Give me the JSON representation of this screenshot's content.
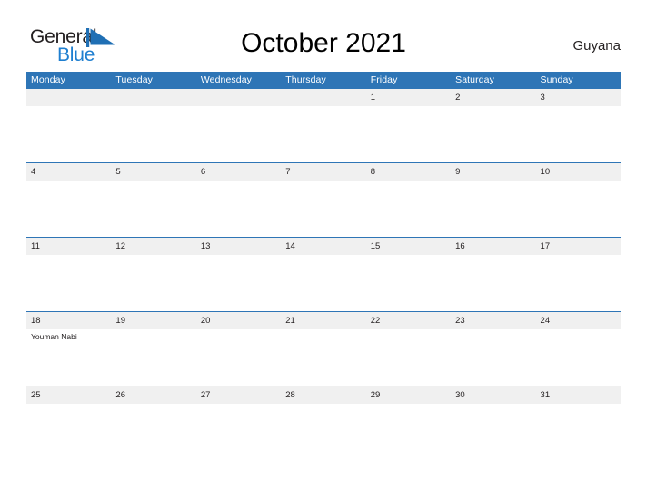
{
  "brand": {
    "name_part1": "General",
    "name_part2": "Blue",
    "flag_icon": "blue-triangle-flag-icon",
    "color_dark": "#231F20",
    "color_blue": "#1F7FD0"
  },
  "header": {
    "title": "October 2021",
    "country": "Guyana"
  },
  "calendar": {
    "accent_color": "#2E75B6",
    "band_color": "#F0F0F0",
    "weekday_headers": [
      "Monday",
      "Tuesday",
      "Wednesday",
      "Thursday",
      "Friday",
      "Saturday",
      "Sunday"
    ],
    "weeks": [
      [
        {
          "day": "",
          "events": []
        },
        {
          "day": "",
          "events": []
        },
        {
          "day": "",
          "events": []
        },
        {
          "day": "",
          "events": []
        },
        {
          "day": "1",
          "events": []
        },
        {
          "day": "2",
          "events": []
        },
        {
          "day": "3",
          "events": []
        }
      ],
      [
        {
          "day": "4",
          "events": []
        },
        {
          "day": "5",
          "events": []
        },
        {
          "day": "6",
          "events": []
        },
        {
          "day": "7",
          "events": []
        },
        {
          "day": "8",
          "events": []
        },
        {
          "day": "9",
          "events": []
        },
        {
          "day": "10",
          "events": []
        }
      ],
      [
        {
          "day": "11",
          "events": []
        },
        {
          "day": "12",
          "events": []
        },
        {
          "day": "13",
          "events": []
        },
        {
          "day": "14",
          "events": []
        },
        {
          "day": "15",
          "events": []
        },
        {
          "day": "16",
          "events": []
        },
        {
          "day": "17",
          "events": []
        }
      ],
      [
        {
          "day": "18",
          "events": [
            "Youman Nabi"
          ]
        },
        {
          "day": "19",
          "events": []
        },
        {
          "day": "20",
          "events": []
        },
        {
          "day": "21",
          "events": []
        },
        {
          "day": "22",
          "events": []
        },
        {
          "day": "23",
          "events": []
        },
        {
          "day": "24",
          "events": []
        }
      ],
      [
        {
          "day": "25",
          "events": []
        },
        {
          "day": "26",
          "events": []
        },
        {
          "day": "27",
          "events": []
        },
        {
          "day": "28",
          "events": []
        },
        {
          "day": "29",
          "events": []
        },
        {
          "day": "30",
          "events": []
        },
        {
          "day": "31",
          "events": []
        }
      ]
    ]
  }
}
